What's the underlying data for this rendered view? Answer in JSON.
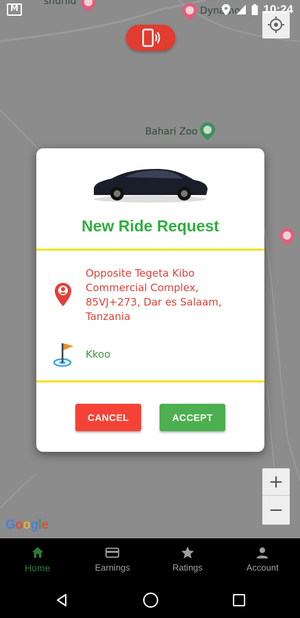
{
  "status_bar": {
    "time": "10:24",
    "icons": [
      "gmail-icon",
      "location-icon",
      "signal-icon",
      "battery-icon"
    ]
  },
  "map": {
    "labels": {
      "zoo": "Bahari Zoo",
      "top_left_partial": "snurlid",
      "top_right_partial": "Dynamo"
    },
    "zoom_in": "+",
    "zoom_out": "−",
    "google_logo": [
      "G",
      "o",
      "o",
      "g",
      "l",
      "e"
    ]
  },
  "dialog": {
    "title": "New Ride Request",
    "pickup_address": "Opposite Tegeta Kibo Commercial Complex, 85VJ+273, Dar es Salaam, Tanzania",
    "destination": "Kkoo",
    "cancel_label": "CANCEL",
    "accept_label": "ACCEPT",
    "colors": {
      "title": "#2fae3f",
      "pickup": "#e2403a",
      "destination": "#3a9b3d",
      "divider": "#f4e21a",
      "cancel": "#f44336",
      "accept": "#4caf50"
    }
  },
  "bottom_nav": {
    "items": [
      {
        "label": "Home",
        "icon": "home-icon",
        "active": true
      },
      {
        "label": "Earnings",
        "icon": "card-icon",
        "active": false
      },
      {
        "label": "Ratings",
        "icon": "star-icon",
        "active": false
      },
      {
        "label": "Account",
        "icon": "person-icon",
        "active": false
      }
    ]
  },
  "system_nav": {
    "icons": [
      "back-icon",
      "home-circle-icon",
      "recents-icon"
    ]
  }
}
